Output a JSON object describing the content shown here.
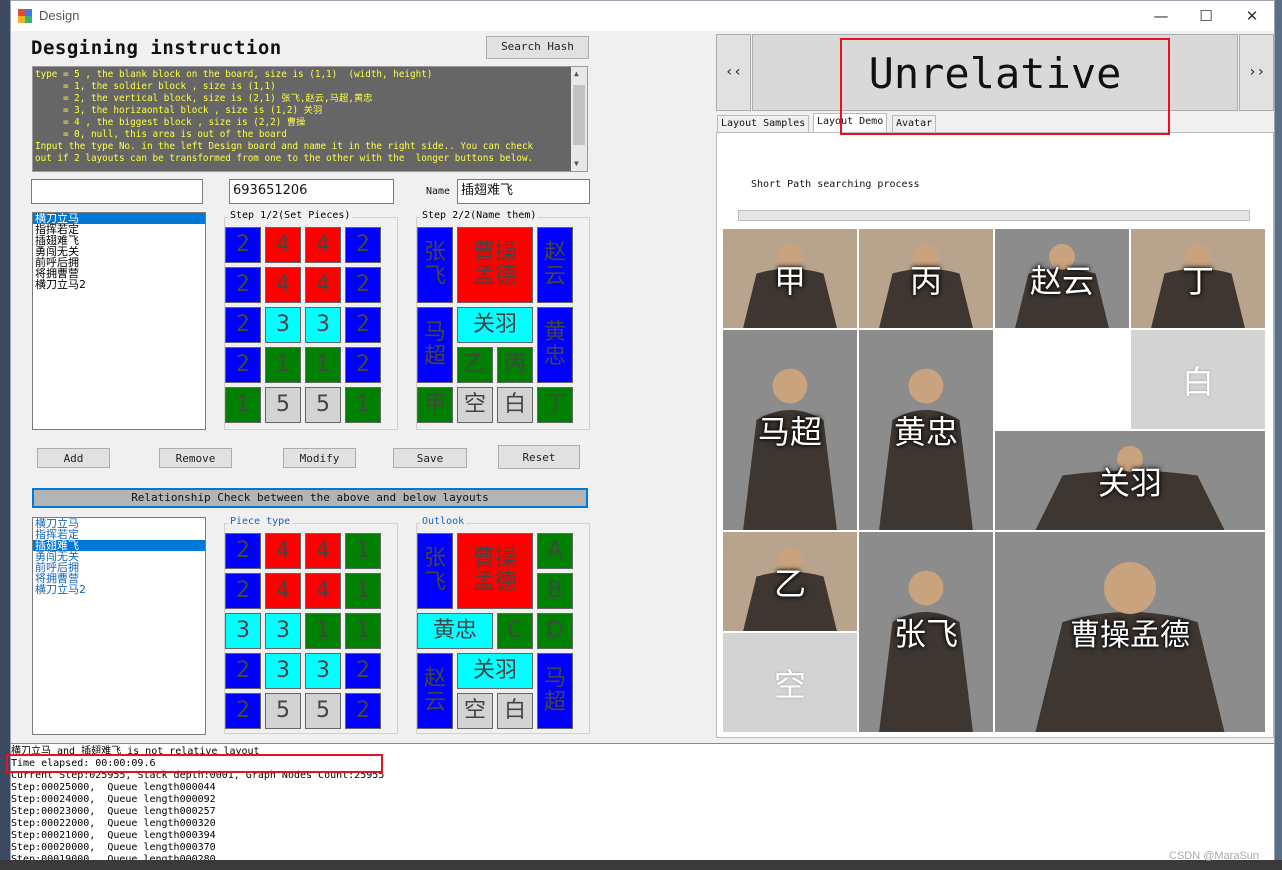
{
  "window": {
    "title": "Design"
  },
  "caption_buttons": {
    "minimize": "—",
    "maximize": "☐",
    "close": "✕"
  },
  "design": {
    "heading": "Desgining instruction",
    "search_hash_label": "Search Hash",
    "instructions": "type = 5 , the blank block on the board, size is (1,1)  (width, height)\n     = 1, the soldier block , size is (1,1)\n     = 2, the vertical block, size is (2,1) 张飞,赵云,马超,黄忠\n     = 3, the horizaontal block , size is (1,2) 关羽\n     = 4 , the biggest block , size is (2,2) 曹操\n     = 0, null, this area is out of the board\nInput the type No. in the left Design board and name it in the right side.. You can check\nout if 2 layouts can be transformed from one to the other with the  longer buttons below.",
    "name_filter_value": "",
    "hash_value": "693651206",
    "name_label": "Name",
    "name_value": "插翅难飞",
    "layouts": [
      "横刀立马",
      "指挥若定",
      "插翅难飞",
      "勇闯无关",
      "前呼后拥",
      "将拥曹营",
      "横刀立马2"
    ],
    "top_selected_index": 0,
    "step1_label": "Step 1/2(Set Pieces)",
    "step2_label": "Step 2/2(Name them)",
    "step1_grid": [
      [
        "2",
        "4",
        "4",
        "2"
      ],
      [
        "2",
        "4",
        "4",
        "2"
      ],
      [
        "2",
        "3",
        "3",
        "2"
      ],
      [
        "2",
        "1",
        "1",
        "2"
      ],
      [
        "1",
        "5",
        "5",
        "1"
      ]
    ],
    "step2_blocks": [
      {
        "text": "张飞",
        "color": "#0000ff"
      },
      {
        "text": "曹操孟德",
        "color": "#ff0000"
      },
      {
        "text": "赵云",
        "color": "#0000ff"
      },
      {
        "text": "马超",
        "color": "#0000ff"
      },
      {
        "text": "关羽",
        "color": "#00ffff"
      },
      {
        "text": "黄忠",
        "color": "#0000ff"
      },
      {
        "text": "乙",
        "color": "#008000"
      },
      {
        "text": "丙",
        "color": "#008000"
      },
      {
        "text": "甲",
        "color": "#008000"
      },
      {
        "text": "空",
        "color": "#d3d3d3"
      },
      {
        "text": "白",
        "color": "#d3d3d3"
      },
      {
        "text": "丁",
        "color": "#008000"
      }
    ],
    "buttons": {
      "add": "Add",
      "remove": "Remove",
      "modify": "Modify",
      "save": "Save",
      "reset": "Reset"
    },
    "relationship_check_label": "Relationship Check between the above and below layouts",
    "bottom_selected_index": 2,
    "piece_type_label": "Piece type",
    "outlook_label": "Outlook",
    "piece_type_grid": [
      [
        "2",
        "4",
        "4",
        "1"
      ],
      [
        "2",
        "4",
        "4",
        "1"
      ],
      [
        "3",
        "3",
        "1",
        "1"
      ],
      [
        "2",
        "3",
        "3",
        "2"
      ],
      [
        "2",
        "5",
        "5",
        "2"
      ]
    ],
    "outlook_blocks": [
      {
        "text": "张飞",
        "color": "#0000ff"
      },
      {
        "text": "曹操孟德",
        "color": "#ff0000"
      },
      {
        "text": "A",
        "color": "#008000"
      },
      {
        "text": "B",
        "color": "#008000"
      },
      {
        "text": "黄忠",
        "color": "#00ffff"
      },
      {
        "text": "C",
        "color": "#008000"
      },
      {
        "text": "D",
        "color": "#008000"
      },
      {
        "text": "赵云",
        "color": "#0000ff"
      },
      {
        "text": "关羽",
        "color": "#00ffff"
      },
      {
        "text": "马超",
        "color": "#0000ff"
      },
      {
        "text": "空",
        "color": "#d3d3d3"
      },
      {
        "text": "白",
        "color": "#d3d3d3"
      }
    ]
  },
  "log": {
    "lines": [
      "横刀立马 and 插翅难飞 is not relative layout",
      "Time elapsed: 00:00:09.6",
      "Current Step:025955, Stack depth:0001, Graph Nodes Count:25955",
      "Step:00025000,  Queue length000044",
      "Step:00024000,  Queue length000092",
      "Step:00023000,  Queue length000257",
      "Step:00022000,  Queue length000320",
      "Step:00021000,  Queue length000394",
      "Step:00020000,  Queue length000370",
      "Step:00019000,  Queue length000280"
    ]
  },
  "right": {
    "prev_label": "‹‹",
    "next_label": "››",
    "result_title": "Unrelative",
    "tabs": [
      "Layout Samples",
      "Layout Demo",
      "Avatar"
    ],
    "active_tab": 1,
    "short_path_label": "Short Path searching process",
    "progress": 0,
    "board_tiles": [
      {
        "name": "甲",
        "kind": "soldier"
      },
      {
        "name": "丙",
        "kind": "soldier"
      },
      {
        "name": "赵云",
        "kind": "portrait"
      },
      {
        "name": "丁",
        "kind": "soldier"
      },
      {
        "name": "马超",
        "kind": "portrait"
      },
      {
        "name": "黄忠",
        "kind": "portrait"
      },
      {
        "name": "白",
        "kind": "blank"
      },
      {
        "name": "关羽",
        "kind": "portrait"
      },
      {
        "name": "乙",
        "kind": "soldier"
      },
      {
        "name": "张飞",
        "kind": "portrait"
      },
      {
        "name": "曹操孟德",
        "kind": "portrait"
      },
      {
        "name": "空",
        "kind": "blank"
      }
    ]
  },
  "watermark": "CSDN @MaraSun"
}
